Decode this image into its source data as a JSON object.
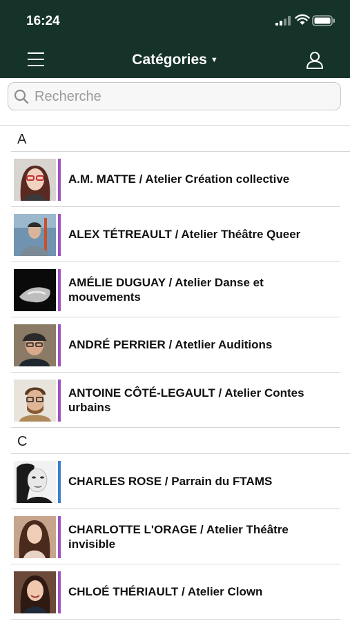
{
  "status": {
    "time": "16:24"
  },
  "nav": {
    "title": "Catégories",
    "caret": "▼"
  },
  "search": {
    "placeholder": "Recherche"
  },
  "colors": {
    "header_bg": "#16332a",
    "purple": "#a052c0",
    "blue": "#3b7fd0"
  },
  "sections": [
    {
      "letter": "A",
      "items": [
        {
          "label": "A.M. MATTE / Atelier Création collective",
          "bar": "purple",
          "avatar": "woman-glasses-red-hair"
        },
        {
          "label": "ALEX TÉTREAULT / Atelier Théâtre Queer",
          "bar": "purple",
          "avatar": "man-cap-outdoor"
        },
        {
          "label": "AMÉLIE DUGUAY / Atelier Danse et mouvements",
          "bar": "purple",
          "avatar": "bw-dancer"
        },
        {
          "label": "ANDRÉ PERRIER / Atetlier Auditions",
          "bar": "purple",
          "avatar": "man-cap-glasses"
        },
        {
          "label": "ANTOINE CÔTÉ-LEGAULT / Atelier Contes urbains",
          "bar": "purple",
          "avatar": "man-beard-glasses"
        }
      ]
    },
    {
      "letter": "C",
      "items": [
        {
          "label": "CHARLES ROSE / Parrain du FTAMS",
          "bar": "blue",
          "avatar": "bw-portrait"
        },
        {
          "label": "CHARLOTTE L'ORAGE / Atelier Théâtre invisible",
          "bar": "purple",
          "avatar": "woman-long-hair"
        },
        {
          "label": "CHLOÉ THÉRIAULT / Atelier Clown",
          "bar": "purple",
          "avatar": "woman-smiling"
        }
      ]
    }
  ]
}
